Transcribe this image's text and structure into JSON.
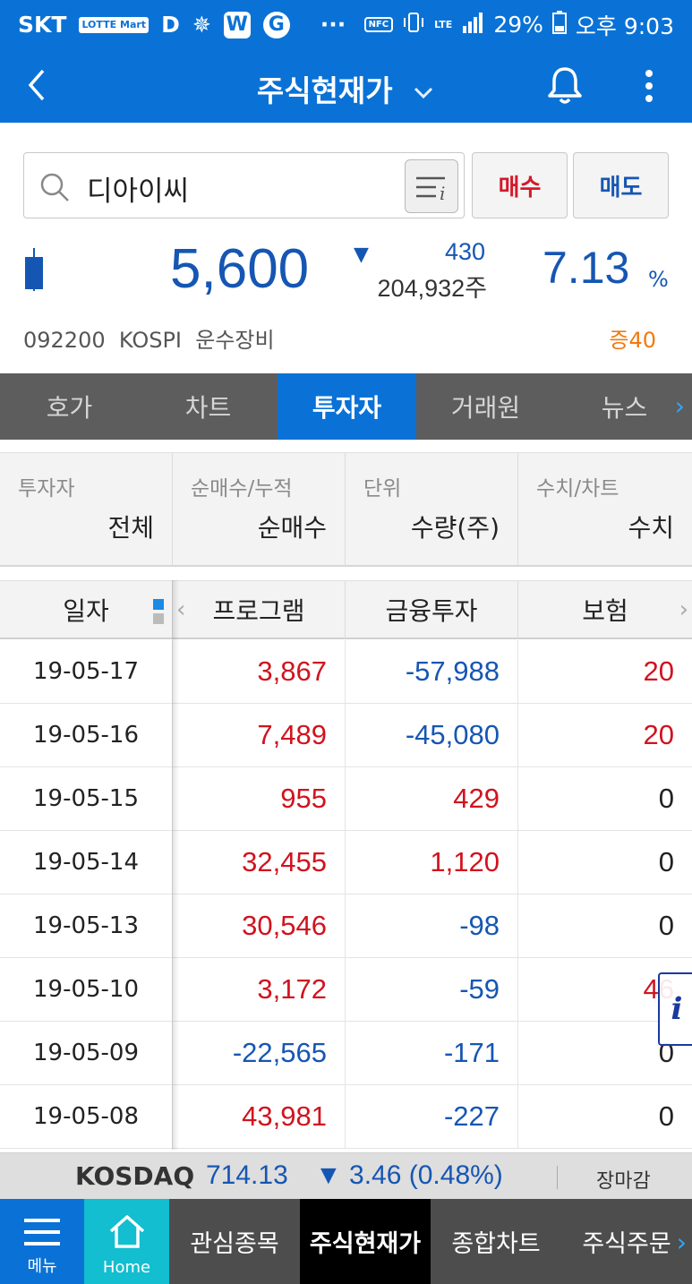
{
  "status_bar": {
    "carrier": "SKT",
    "lotte_badge": "LOTTE Mart",
    "app_icons": [
      "D",
      "W",
      "G"
    ],
    "dots": "···",
    "nfc": "NFC",
    "lte": "LTE",
    "battery_pct": "29%",
    "time": "오후 9:03"
  },
  "header": {
    "title": "주식현재가",
    "back_icon": "chevron-left-icon",
    "bell_icon": "bell-icon",
    "more_icon": "kebab-menu-icon"
  },
  "search": {
    "value": "디아이씨",
    "buy_label": "매수",
    "sell_label": "매도"
  },
  "quote": {
    "price": "5,600",
    "change": "430",
    "volume": "204,932주",
    "percent": "7.13",
    "percent_unit": "%",
    "code": "092200",
    "market": "KOSPI",
    "sector": "운수장비",
    "margin": "증40"
  },
  "tabs": [
    "호가",
    "차트",
    "투자자",
    "거래원",
    "뉴스"
  ],
  "active_tab": "투자자",
  "filters": [
    {
      "label": "투자자",
      "value": "전체"
    },
    {
      "label": "순매수/누적",
      "value": "순매수"
    },
    {
      "label": "단위",
      "value": "수량(주)"
    },
    {
      "label": "수치/차트",
      "value": "수치"
    }
  ],
  "table": {
    "columns": [
      "일자",
      "프로그램",
      "금융투자",
      "보험"
    ],
    "rows": [
      {
        "date": "19-05-17",
        "program": "3,867",
        "fin": "-57,988",
        "ins": "20"
      },
      {
        "date": "19-05-16",
        "program": "7,489",
        "fin": "-45,080",
        "ins": "20"
      },
      {
        "date": "19-05-15",
        "program": "955",
        "fin": "429",
        "ins": "0"
      },
      {
        "date": "19-05-14",
        "program": "32,455",
        "fin": "1,120",
        "ins": "0"
      },
      {
        "date": "19-05-13",
        "program": "30,546",
        "fin": "-98",
        "ins": "0"
      },
      {
        "date": "19-05-10",
        "program": "3,172",
        "fin": "-59",
        "ins": "46"
      },
      {
        "date": "19-05-09",
        "program": "-22,565",
        "fin": "-171",
        "ins": "0"
      },
      {
        "date": "19-05-08",
        "program": "43,981",
        "fin": "-227",
        "ins": "0"
      }
    ]
  },
  "info_button": "i",
  "ticker": {
    "name": "KOSDAQ",
    "index": "714.13",
    "change": "▼ 3.46 (0.48%)",
    "status": "장마감"
  },
  "bottom_nav": {
    "menu": "메뉴",
    "home": "Home",
    "items": [
      "관심종목",
      "주식현재가",
      "종합차트",
      "주식주문"
    ],
    "active": "주식현재가"
  },
  "colors": {
    "brand_blue": "#0a72d6",
    "up_red": "#d0131f",
    "down_blue": "#1656b3",
    "home_teal": "#12bed0"
  }
}
